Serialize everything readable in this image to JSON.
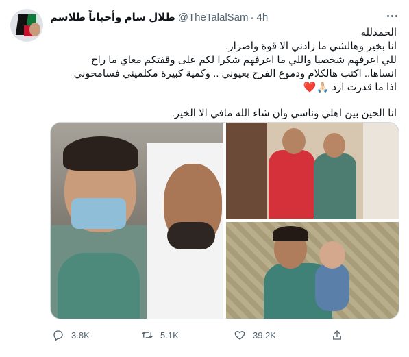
{
  "user": {
    "display_name": "طلال سام وأحياناً طلاسم",
    "handle": "@TheTalalSam",
    "separator": "·",
    "time": "4h"
  },
  "tweet_lines": [
    "الحمدلله",
    "انا بخير وهالشي ما زادني الا قوة واصرار.",
    "للي اعرفهم شخصيا واللي ما اعرفهم شكرا لكم على وقفتكم معاي ما راح",
    "انساها.. اكتب هالكلام ودموع الفرح بعيوني .. وكمية كبيرة مكلميني فسامحوني",
    "اذا ما قدرت ارد 🙏🏻❤️",
    "",
    "انا الحين بين اهلي وناسي وان شاء الله مافي الا الخير."
  ],
  "actions": {
    "reply_count": "3.8K",
    "retweet_count": "5.1K",
    "like_count": "39.2K"
  },
  "icons": {
    "more": "more-icon",
    "reply": "reply-icon",
    "retweet": "retweet-icon",
    "like": "heart-icon",
    "share": "share-icon"
  },
  "colors": {
    "text": "#0f1419",
    "secondary": "#536471",
    "border": "#cfd9de"
  }
}
